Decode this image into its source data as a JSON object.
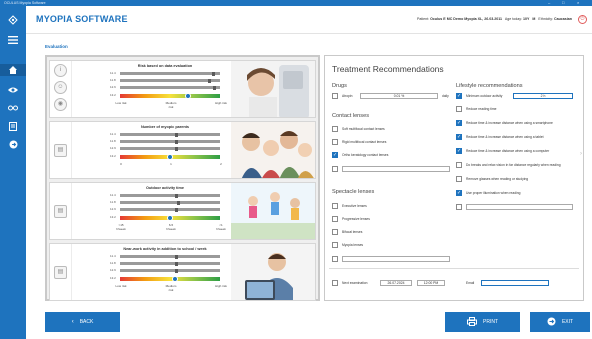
{
  "window": {
    "title": "OCULUS Myopia Software",
    "controls": [
      "–",
      "□",
      "×"
    ]
  },
  "app": {
    "brand": "MYOPIA SOFTWARE"
  },
  "patient": {
    "label": "Patient:",
    "name": "Oculus E MC Demo Myopia XL, 26.03.2011",
    "age_label": "Age today:",
    "age": "10Y",
    "sex": "M",
    "eth_label": "Ethnicity:",
    "ethnicity": "Caucasian"
  },
  "breadcrumb": "Evaluation",
  "sidebar": {
    "icons": [
      "logo-icon",
      "menu-icon",
      "home-icon",
      "eye-icon",
      "glasses-icon",
      "report-icon",
      "exit-icon"
    ]
  },
  "evaluation": {
    "cards": [
      {
        "title": "Risk based on data evaluation",
        "rows": [
          "11.4",
          "11.8",
          "12.6",
          "13.2"
        ],
        "axis": [
          "Low risk",
          "Medium risk",
          "High risk"
        ],
        "markers": [
          0.92,
          0.88,
          0.93
        ],
        "dot": 0.68
      },
      {
        "title": "Number of myopic parents",
        "rows": [
          "11.4",
          "11.8",
          "12.9",
          "13.2"
        ],
        "axis": [
          "0",
          "1",
          "2"
        ],
        "markers": [
          0.55,
          0.55,
          0.55
        ],
        "dot": 0.5
      },
      {
        "title": "Outdoor activity time",
        "rows": [
          "11.4",
          "11.8",
          "12.9",
          "13.2"
        ],
        "axis": [
          ">15\nh/week",
          "6-5\nh/week",
          "<1\nh/week"
        ],
        "markers": [
          0.55,
          0.57,
          0.55
        ],
        "dot": 0.5
      },
      {
        "title": "Near-work activity in addition to school / week",
        "rows": [
          "11.4",
          "11.8",
          "12.9",
          "13.2"
        ],
        "axis": [
          "Low risk",
          "Medium risk",
          "High risk"
        ],
        "markers": [
          0.55,
          0.55,
          0.55
        ],
        "dot": 0.55
      }
    ]
  },
  "recommendations": {
    "title": "Treatment Recommendations",
    "drugs": {
      "heading": "Drugs",
      "atropine_label": "Atropin",
      "atropine_value": "0.01 %",
      "unit": "daily"
    },
    "contact_lenses": {
      "heading": "Contact lenses",
      "items": [
        {
          "label": "Soft multifocal contact lenses",
          "checked": false
        },
        {
          "label": "Rigid multifocal contact lenses",
          "checked": false
        },
        {
          "label": "Ortho keratology contact lenses",
          "checked": true
        }
      ]
    },
    "spectacle_lenses": {
      "heading": "Spectacle lenses",
      "items": [
        {
          "label": "Executive lenses",
          "checked": false
        },
        {
          "label": "Progressive lenses",
          "checked": false
        },
        {
          "label": "Bifocal lenses",
          "checked": false
        },
        {
          "label": "Myopia lenses",
          "checked": false
        }
      ]
    },
    "lifestyle": {
      "heading": "Lifestyle recommendations",
      "outdoor_label": "Minimum outdoor activity",
      "outdoor_value": "2 h",
      "items": [
        {
          "label": "Reduce reading time",
          "checked": false
        },
        {
          "label": "Reduce time & increase distance when using a smartphone",
          "checked": true
        },
        {
          "label": "Reduce time & increase distance when using a tablet",
          "checked": true
        },
        {
          "label": "Reduce time & increase distance when using a computer",
          "checked": true
        },
        {
          "label": "Do breaks and relax vision in far distance regularly when reading",
          "checked": false
        },
        {
          "label": "Remove glasses when reading or studying",
          "checked": false
        },
        {
          "label": "Use proper illumination when reading",
          "checked": true
        }
      ]
    },
    "next_exam": {
      "label": "Next examination",
      "date": "26.07.2024",
      "time": "12:00 PM",
      "email_label": "Email"
    }
  },
  "buttons": {
    "back": "BACK",
    "print": "PRINT",
    "exit": "EXIT"
  },
  "colors": {
    "brand": "#1e73be",
    "accent": "#e05b5b"
  }
}
